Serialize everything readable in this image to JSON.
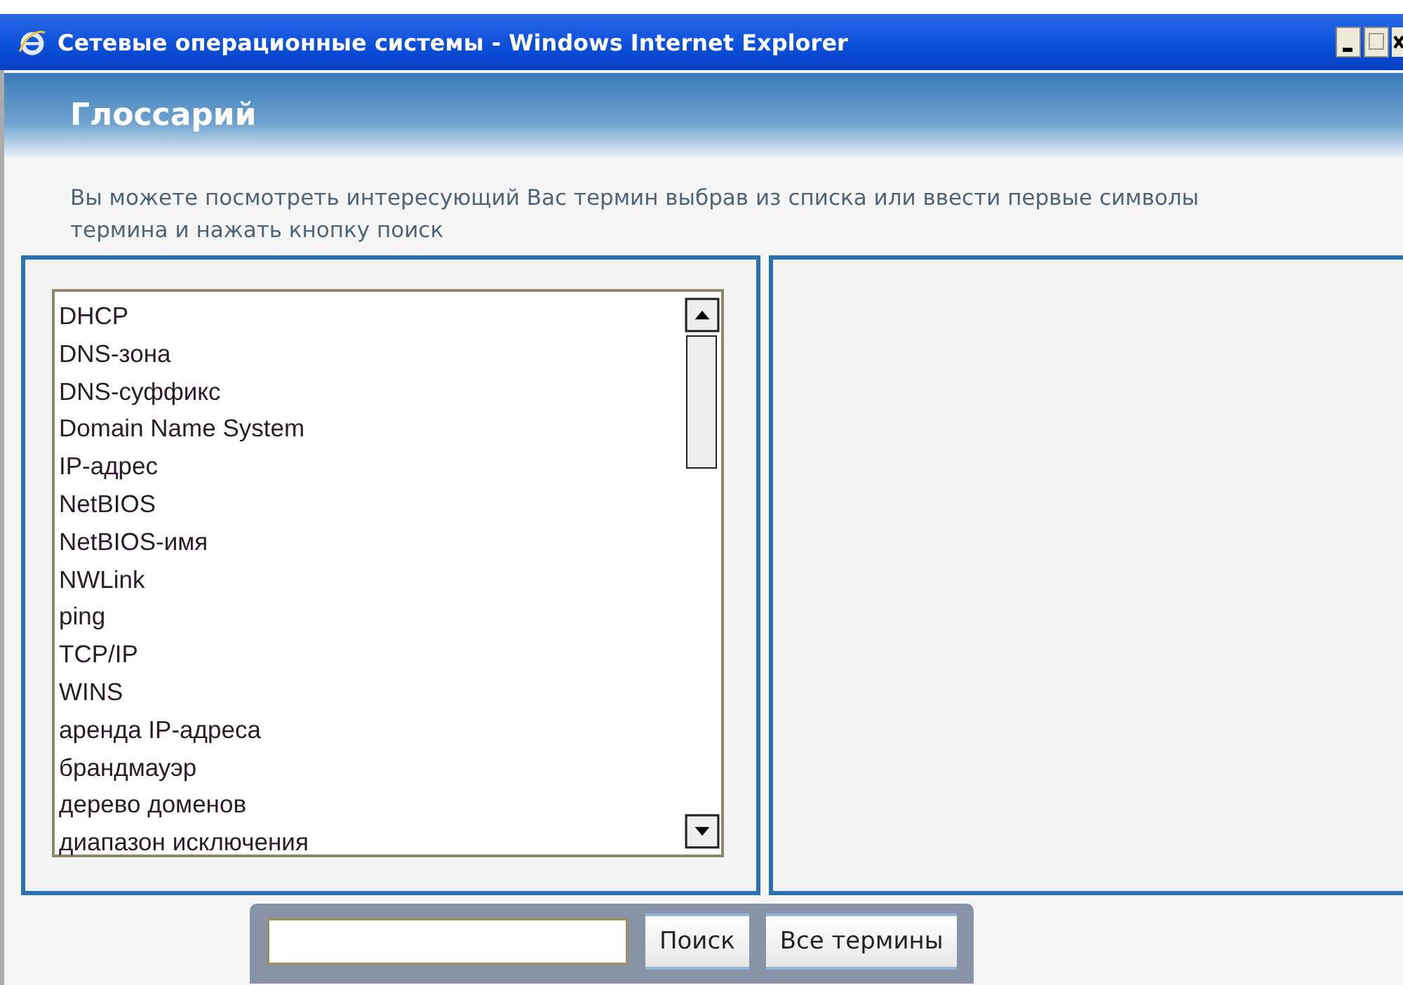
{
  "window": {
    "title": "Сетевые операционные системы - Windows Internet Explorer"
  },
  "header": {
    "title": "Глоссарий"
  },
  "intro": "Вы можете посмотреть интересующий Вас термин выбрав из списка или ввести первые символы термина и нажать кнопку поиск",
  "terms": [
    {
      "label": "DHCP",
      "selected": false
    },
    {
      "label": "DNS-зона",
      "selected": false
    },
    {
      "label": "DNS-суффикс",
      "selected": false
    },
    {
      "label": "Domain Name System",
      "selected": false
    },
    {
      "label": "IP-адрес",
      "selected": false
    },
    {
      "label": "NetBIOS",
      "selected": false
    },
    {
      "label": "NetBIOS-имя",
      "selected": false
    },
    {
      "label": "NWLink",
      "selected": false
    },
    {
      "label": "ping",
      "selected": false
    },
    {
      "label": "TCP/IP",
      "selected": false
    },
    {
      "label": "WINS",
      "selected": false
    },
    {
      "label": "аренда IP-адреса",
      "selected": false
    },
    {
      "label": "брандмауэр",
      "selected": false
    },
    {
      "label": "дерево доменов",
      "selected": false
    },
    {
      "label": "диапазон исключения",
      "selected": false
    }
  ],
  "buttons": [
    {
      "label": "Поиск"
    },
    {
      "label": "Все термины"
    }
  ]
}
